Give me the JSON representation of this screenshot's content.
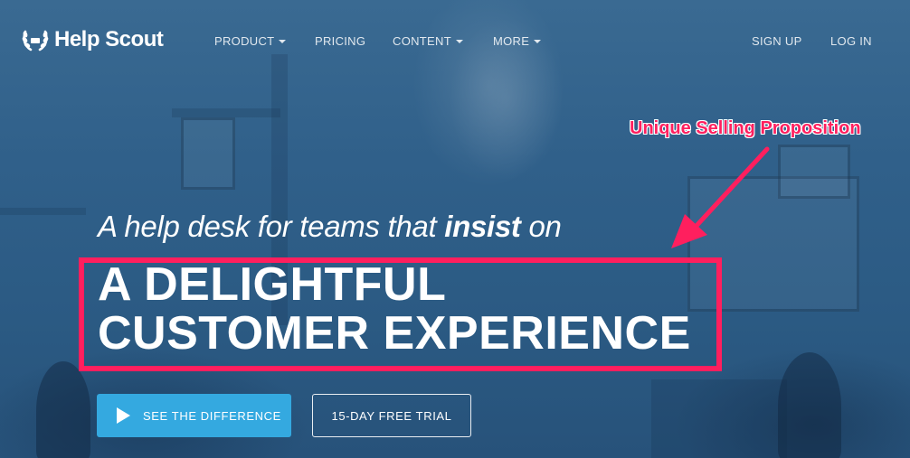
{
  "brand": {
    "name": "Help Scout"
  },
  "nav": {
    "items": [
      {
        "label": "PRODUCT",
        "has_dropdown": true
      },
      {
        "label": "PRICING",
        "has_dropdown": false
      },
      {
        "label": "CONTENT",
        "has_dropdown": true
      },
      {
        "label": "MORE",
        "has_dropdown": true
      }
    ],
    "sign_up": "SIGN UP",
    "log_in": "LOG IN"
  },
  "hero": {
    "tagline_pre": "A help desk for teams that ",
    "tagline_bold": "insist",
    "tagline_post": " on",
    "headline_line1": "A DELIGHTFUL",
    "headline_line2": "CUSTOMER EXPERIENCE",
    "cta_primary": "SEE THE DIFFERENCE",
    "cta_secondary": "15-DAY FREE TRIAL"
  },
  "annotation": {
    "text": "Unique Selling Proposition"
  },
  "colors": {
    "background": "#2f5e86",
    "highlight": "#ff1f5e",
    "primary_button": "#34a9e0",
    "text": "#ffffff"
  },
  "icons": {
    "logo": "laurel-wreath-icon",
    "dropdown": "caret-down-icon",
    "play": "play-icon"
  }
}
